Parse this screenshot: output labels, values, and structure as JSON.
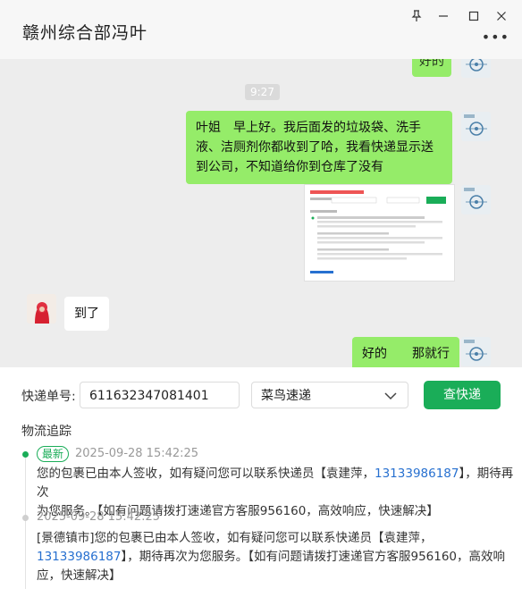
{
  "window": {
    "title": "赣州综合部冯叶",
    "pin_glyph": "⊥",
    "min_glyph": "—",
    "max_glyph": "☐",
    "close_glyph": "✕",
    "more_glyph": "•••"
  },
  "chat": {
    "top_partial_text": "好的",
    "timestamp": "9:27",
    "msg_me_1": "叶姐　早上好。我后面发的垃圾袋、洗手液、洁厕剂你都收到了哈，我看快递显示送到公司，不知道给你到仓库了没有",
    "msg_them_1": "到了",
    "msg_me_2": "好的　　那就行"
  },
  "express": {
    "tracking_label": "快递单号:",
    "tracking_value": "611632347081401",
    "carrier_value": "菜鸟速递",
    "query_label": "查快递",
    "tracking_title": "物流追踪",
    "entries": [
      {
        "badge": "最新",
        "time": "2025-09-28 15:42:25",
        "line1_a": "您的包裹已由本人签收，如有疑问您可以联系快递员【袁建萍，",
        "phone": "13133986187",
        "line1_b": "】，期待再次",
        "line2": "为您服务。【如有问题请拨打速递官方客服956160，高效响应，快速解决】"
      },
      {
        "time": "2025-09-28 15:42:25",
        "line1": "[景德镇市]您的包裹已由本人签收，如有疑问您可以联系快递员【袁建萍，",
        "phone": "13133986187",
        "line2_b": "】，期待再次为您服务。【如有问题请拨打速递官方客服956160，高效响",
        "line3": "应，快速解决】"
      }
    ]
  },
  "colors": {
    "accent": "#1aad58",
    "bubble_me": "#95ec69",
    "phone": "#2770d0"
  }
}
